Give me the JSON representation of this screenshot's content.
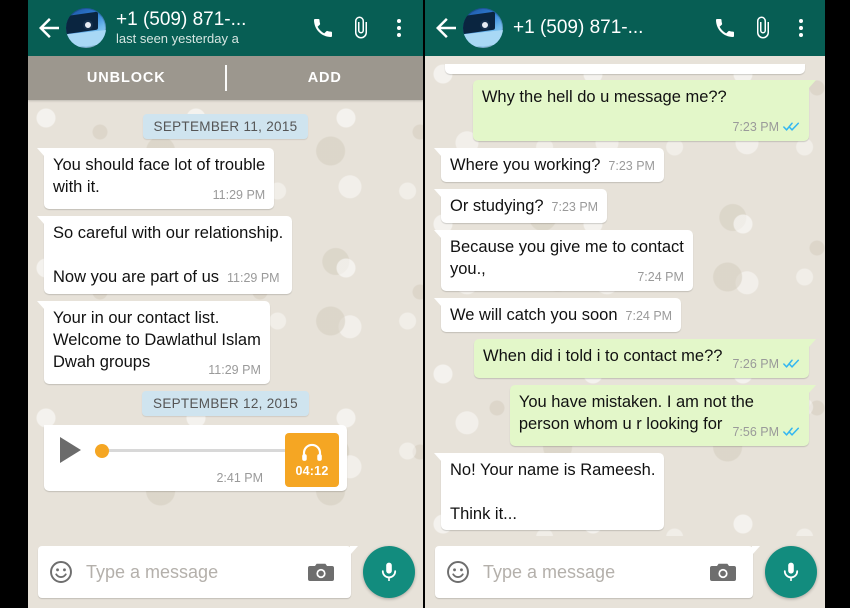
{
  "theme": {
    "header_bg": "#075e54",
    "chat_bg": "#e7e2d9",
    "incoming_bubble": "#ffffff",
    "outgoing_bubble": "#e3f7c9",
    "date_chip": "#cfe4ef",
    "block_bar": "#9c978e",
    "accent_orange": "#f5a623",
    "mic_green": "#128c7e",
    "tick_blue": "#34b7f1",
    "frame": "#000000"
  },
  "left": {
    "header": {
      "back_icon": "back-arrow-icon",
      "avatar": "contact-avatar",
      "title": "+1 (509) 871-...",
      "subtitle": "last seen yesterday a",
      "call_icon": "phone-icon",
      "attach_icon": "paperclip-icon",
      "menu_icon": "overflow-menu-icon"
    },
    "block_bar": {
      "unblock_label": "UNBLOCK",
      "add_label": "ADD"
    },
    "messages": [
      {
        "kind": "date",
        "text": "SEPTEMBER 11, 2015"
      },
      {
        "kind": "in",
        "text": "You should face lot of trouble\nwith it.",
        "time": "11:29 PM",
        "inline": false
      },
      {
        "kind": "in",
        "text": "So careful with our relationship.\n\nNow you are part of us",
        "time": "11:29 PM",
        "inline": true
      },
      {
        "kind": "in",
        "text": "Your in our contact list.\nWelcome to Dawlathul Islam\nDwah groups",
        "time": "11:29 PM",
        "inline": false
      },
      {
        "kind": "date",
        "text": "SEPTEMBER 12, 2015"
      },
      {
        "kind": "audio",
        "time": "2:41 PM",
        "duration": "04:12",
        "progress_percent": 0,
        "play_icon": "play-icon",
        "badge_icon": "headphones-icon"
      }
    ],
    "composer": {
      "emoji_icon": "emoji-smiley-icon",
      "placeholder": "Type a message",
      "value": "",
      "camera_icon": "camera-icon",
      "mic_icon": "microphone-icon"
    }
  },
  "right": {
    "header": {
      "back_icon": "back-arrow-icon",
      "avatar": "contact-avatar",
      "title": "+1 (509) 871-...",
      "subtitle": "",
      "call_icon": "phone-icon",
      "attach_icon": "paperclip-icon",
      "menu_icon": "overflow-menu-icon"
    },
    "messages": [
      {
        "kind": "out",
        "text": "Why the hell do u message me??",
        "time": "7:23 PM",
        "ticks": "read",
        "inline": false
      },
      {
        "kind": "in",
        "text": "Where you working?",
        "time": "7:23 PM",
        "inline": true
      },
      {
        "kind": "in",
        "text": "Or studying?",
        "time": "7:23 PM",
        "inline": true
      },
      {
        "kind": "in",
        "text": "Because you give me to contact\nyou.,",
        "time": "7:24 PM",
        "inline": false
      },
      {
        "kind": "in",
        "text": "We will catch you soon",
        "time": "7:24 PM",
        "inline": true
      },
      {
        "kind": "out",
        "text": "When did i told i to contact me??",
        "time": "7:26 PM",
        "ticks": "read",
        "inline": false
      },
      {
        "kind": "out",
        "text": "You have mistaken. I am not the\nperson whom u r looking for",
        "time": "7:56 PM",
        "ticks": "read",
        "inline": false
      },
      {
        "kind": "in",
        "text": "No! Your name is Rameesh.\n\nThink it...",
        "time": "",
        "inline": false,
        "truncated": true
      }
    ],
    "composer": {
      "emoji_icon": "emoji-smiley-icon",
      "placeholder": "Type a message",
      "value": "",
      "camera_icon": "camera-icon",
      "mic_icon": "microphone-icon"
    }
  }
}
